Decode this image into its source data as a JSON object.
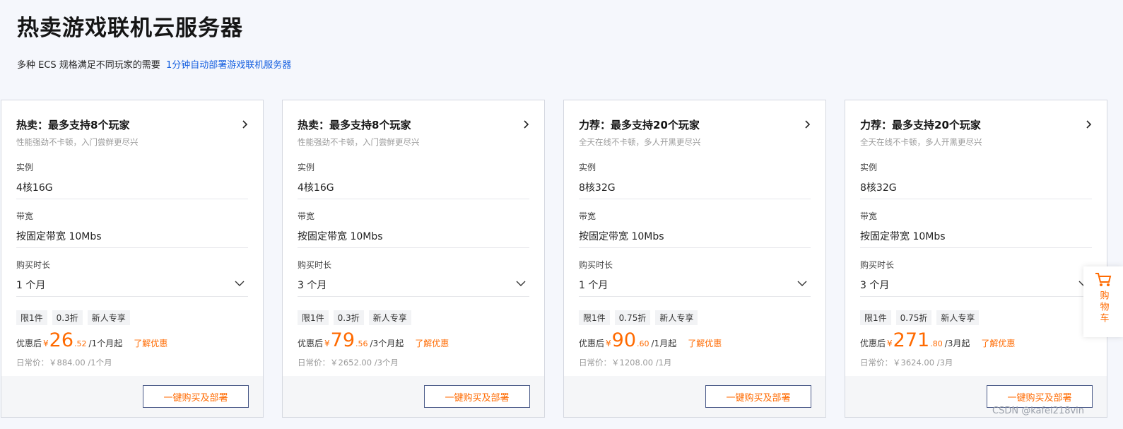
{
  "header": {
    "title": "热卖游戏联机云服务器",
    "subtitle": "多种 ECS 规格满足不同玩家的需要",
    "subtitle_link": "1分钟自动部署游戏联机服务器"
  },
  "colors": {
    "accent": "#ff6a00",
    "link": "#1660e0",
    "button_border": "#4a5a88"
  },
  "cards": [
    {
      "title": "热卖：最多支持8个玩家",
      "desc": "性能强劲不卡顿，入门尝鲜更尽兴",
      "instance_label": "实例",
      "instance_value": "4核16G",
      "bandwidth_label": "带宽",
      "bandwidth_value": "按固定带宽 10Mbs",
      "duration_label": "购买时长",
      "duration_value": "1 个月",
      "tags": [
        "限1件",
        "0.3折",
        "新人专享"
      ],
      "price_prefix": "优惠后",
      "currency": "¥",
      "price_int": "26",
      "price_dec": ".52",
      "price_unit": "/1个月起",
      "learn_more": "了解优惠",
      "regular_price": "日常价：￥884.00 /1个月",
      "buy_label": "一键购买及部署"
    },
    {
      "title": "热卖：最多支持8个玩家",
      "desc": "性能强劲不卡顿，入门尝鲜更尽兴",
      "instance_label": "实例",
      "instance_value": "4核16G",
      "bandwidth_label": "带宽",
      "bandwidth_value": "按固定带宽 10Mbs",
      "duration_label": "购买时长",
      "duration_value": "3 个月",
      "tags": [
        "限1件",
        "0.3折",
        "新人专享"
      ],
      "price_prefix": "优惠后",
      "currency": "¥",
      "price_int": "79",
      "price_dec": ".56",
      "price_unit": "/3个月起",
      "learn_more": "了解优惠",
      "regular_price": "日常价：￥2652.00 /3个月",
      "buy_label": "一键购买及部署"
    },
    {
      "title": "力荐：最多支持20个玩家",
      "desc": "全天在线不卡顿，多人开黑更尽兴",
      "instance_label": "实例",
      "instance_value": "8核32G",
      "bandwidth_label": "带宽",
      "bandwidth_value": "按固定带宽 10Mbs",
      "duration_label": "购买时长",
      "duration_value": "1 个月",
      "tags": [
        "限1件",
        "0.75折",
        "新人专享"
      ],
      "price_prefix": "优惠后",
      "currency": "¥",
      "price_int": "90",
      "price_dec": ".60",
      "price_unit": "/1月起",
      "learn_more": "了解优惠",
      "regular_price": "日常价：￥1208.00 /1月",
      "buy_label": "一键购买及部署"
    },
    {
      "title": "力荐：最多支持20个玩家",
      "desc": "全天在线不卡顿，多人开黑更尽兴",
      "instance_label": "实例",
      "instance_value": "8核32G",
      "bandwidth_label": "带宽",
      "bandwidth_value": "按固定带宽 10Mbs",
      "duration_label": "购买时长",
      "duration_value": "3 个月",
      "tags": [
        "限1件",
        "0.75折",
        "新人专享"
      ],
      "price_prefix": "优惠后",
      "currency": "¥",
      "price_int": "271",
      "price_dec": ".80",
      "price_unit": "/3月起",
      "learn_more": "了解优惠",
      "regular_price": "日常价：￥3624.00 /3月",
      "buy_label": "一键购买及部署"
    }
  ],
  "cart": {
    "label": "购物车",
    "icon": "cart-icon"
  },
  "watermark": "CSDN @kafei218vin"
}
